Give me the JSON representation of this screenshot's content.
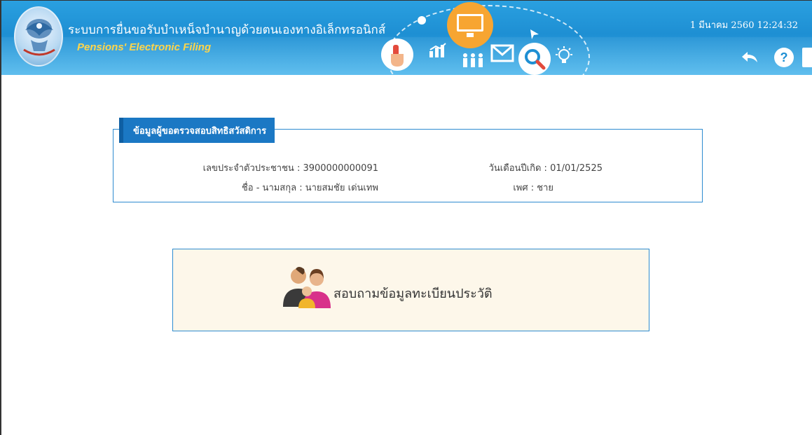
{
  "header": {
    "title_th": "ระบบการยื่นขอรับบำเหน็จบำนาญด้วยตนเองทางอิเล็กทรอนิกส์",
    "title_en": "Pensions' Electronic Filing",
    "datetime": "1 มีนาคม 2560 12:24:32",
    "help_label": "?"
  },
  "info": {
    "legend": "ข้อมูลผู้ขอตรวจสอบสิทธิสวัสดิการ",
    "id_label": "เลขประจำตัวประชาชน",
    "id_value": "3900000000091",
    "name_label": "ชื่อ - นามสกุล",
    "name_value": "นายสมชัย เด่นเทพ",
    "birth_label": "วันเดือนปีเกิด",
    "birth_value": "01/01/2525",
    "gender_label": "เพศ",
    "gender_value": "ชาย"
  },
  "action": {
    "label": "สอบถามข้อมูลทะเบียนประวัติ"
  },
  "colors": {
    "header_blue": "#1e8fd3",
    "accent_orange": "#f7a531",
    "title_yellow": "#ffd54a",
    "panel_border": "#2d8bd0",
    "legend_bg": "#1b78c4",
    "action_bg": "#fdf7ea"
  }
}
